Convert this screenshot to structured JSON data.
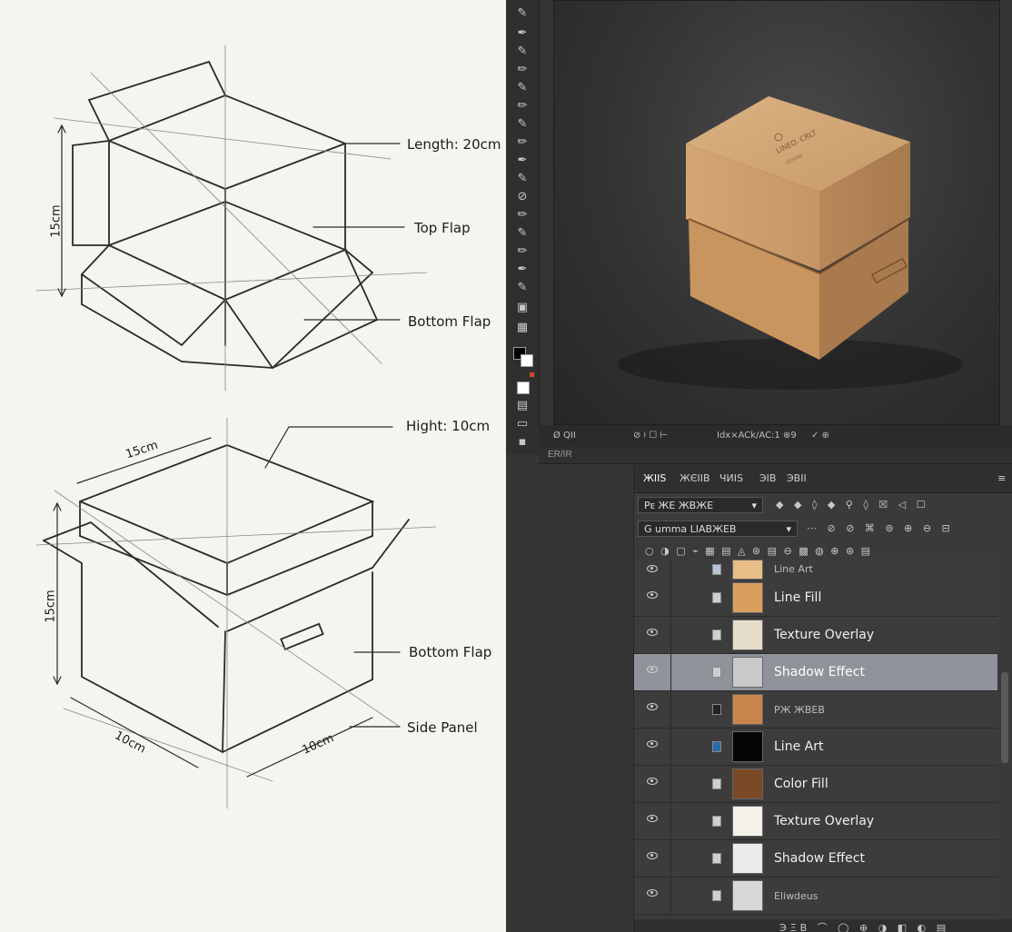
{
  "sketch": {
    "callouts": {
      "length": "Length: 20cm",
      "top_flap": "Top Flap",
      "bottom_flap_upper": "Bottom Flap",
      "hight": "Hight: 10cm",
      "bottom_flap_lower": "Bottom Flap",
      "side_panel": "Side Panel"
    },
    "dimensions": {
      "upper_side": "15cm",
      "lower_top_edge": "15cm",
      "lower_side": "15cm",
      "lower_left_base": "10cm",
      "lower_right_base": "10cm"
    }
  },
  "canvas": {
    "product_label": "LINEO. CRLT",
    "product_sub": "DESIGN"
  },
  "status": {
    "left": "Ø QII",
    "middle": "Idx×ACk/AC:1 ⊕9",
    "right": "✓ ⊕"
  },
  "info_bar": {
    "text": "ER/IR"
  },
  "panel": {
    "tabs": [
      "ЖIIS",
      "ЖЄIIB",
      "ЧИIS",
      "ЭIB",
      "ЭBII"
    ],
    "kind_filter": "Pᴇ ЖE ЖBЖE",
    "blend_mode": "G umma LIABЖEB",
    "filter_icons": "◆ ◆ ◊ ◆ ⚲ ◊ ☒ ◁ ☐",
    "blend_icons": "⋯ ⊘ ⊘ ⌘ ⊚ ⊕ ⊖ ⊟",
    "lock_icons": "○ ◑ ▢ ⌁ ▦ ▤ ◬ ⊛ ▤ ⊖ ▩ ◍ ⊕ ⊛ ▤",
    "footer_icons": "ЭΞB ⌒ ◯ ⊕ ◑ ◧ ◐ ▤"
  },
  "layers": [
    {
      "name": "Line Art",
      "small": true,
      "thumb_color": "#e8be88"
    },
    {
      "name": "Line Fill",
      "small": false,
      "thumb_color": "#d99f5e"
    },
    {
      "name": "Texture Overlay",
      "small": false,
      "thumb_color": "#e6dccb"
    },
    {
      "name": "Shadow Effect",
      "small": false,
      "thumb_color": "#c9c9c9",
      "selected": true
    },
    {
      "name": "PЖ ЖBEB",
      "small": true,
      "thumb_color": "#c8864a"
    },
    {
      "name": "Line Art",
      "small": false,
      "thumb_color": "#050505"
    },
    {
      "name": "Color Fill",
      "small": false,
      "thumb_color": "#7a4a26"
    },
    {
      "name": "Texture Overlay",
      "small": false,
      "thumb_color": "#f4f1ea"
    },
    {
      "name": "Shadow Effect",
      "small": false,
      "thumb_color": "#ebebeb"
    },
    {
      "name": "Eliwdeus",
      "small": true,
      "thumb_color": "#d8d8d8"
    }
  ]
}
